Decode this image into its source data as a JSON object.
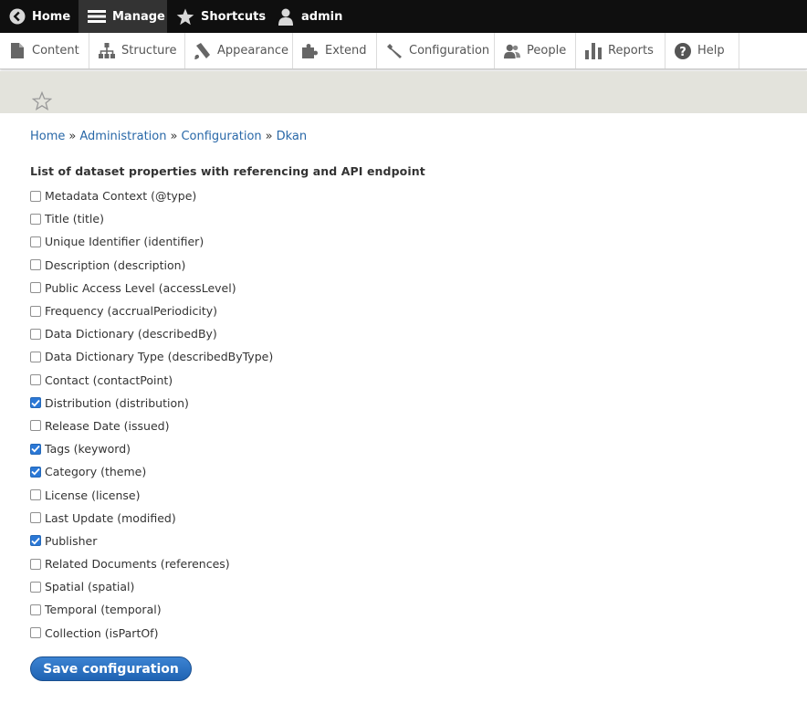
{
  "toolbar": {
    "home_label": "Home",
    "manage_label": "Manage",
    "shortcuts_label": "Shortcuts",
    "user_label": "admin"
  },
  "tray": {
    "items": [
      {
        "label": "Content",
        "icon": "page-icon"
      },
      {
        "label": "Structure",
        "icon": "sitemap-icon"
      },
      {
        "label": "Appearance",
        "icon": "paintbrush-icon"
      },
      {
        "label": "Extend",
        "icon": "puzzle-icon"
      },
      {
        "label": "Configuration",
        "icon": "wrench-icon"
      },
      {
        "label": "People",
        "icon": "people-icon"
      },
      {
        "label": "Reports",
        "icon": "bar-chart-icon"
      },
      {
        "label": "Help",
        "icon": "help-icon"
      }
    ]
  },
  "breadcrumb": {
    "items": [
      "Home",
      "Administration",
      "Configuration",
      "Dkan"
    ],
    "separator": "»"
  },
  "form": {
    "title": "List of dataset properties with referencing and API endpoint",
    "options": [
      {
        "label": "Metadata Context (@type)",
        "checked": false
      },
      {
        "label": "Title (title)",
        "checked": false
      },
      {
        "label": "Unique Identifier (identifier)",
        "checked": false
      },
      {
        "label": "Description (description)",
        "checked": false
      },
      {
        "label": "Public Access Level (accessLevel)",
        "checked": false
      },
      {
        "label": "Frequency (accrualPeriodicity)",
        "checked": false
      },
      {
        "label": "Data Dictionary (describedBy)",
        "checked": false
      },
      {
        "label": "Data Dictionary Type (describedByType)",
        "checked": false
      },
      {
        "label": "Contact (contactPoint)",
        "checked": false
      },
      {
        "label": "Distribution (distribution)",
        "checked": true
      },
      {
        "label": "Release Date (issued)",
        "checked": false
      },
      {
        "label": "Tags (keyword)",
        "checked": true
      },
      {
        "label": "Category (theme)",
        "checked": true
      },
      {
        "label": "License (license)",
        "checked": false
      },
      {
        "label": "Last Update (modified)",
        "checked": false
      },
      {
        "label": "Publisher",
        "checked": true
      },
      {
        "label": "Related Documents (references)",
        "checked": false
      },
      {
        "label": "Spatial (spatial)",
        "checked": false
      },
      {
        "label": "Temporal (temporal)",
        "checked": false
      },
      {
        "label": "Collection (isPartOf)",
        "checked": false
      }
    ],
    "save_label": "Save configuration"
  },
  "colors": {
    "toolbar_bg": "#0f0f0f",
    "link": "#2968a8",
    "accent": "#2b78d6",
    "header_band": "#e3e3dc"
  }
}
